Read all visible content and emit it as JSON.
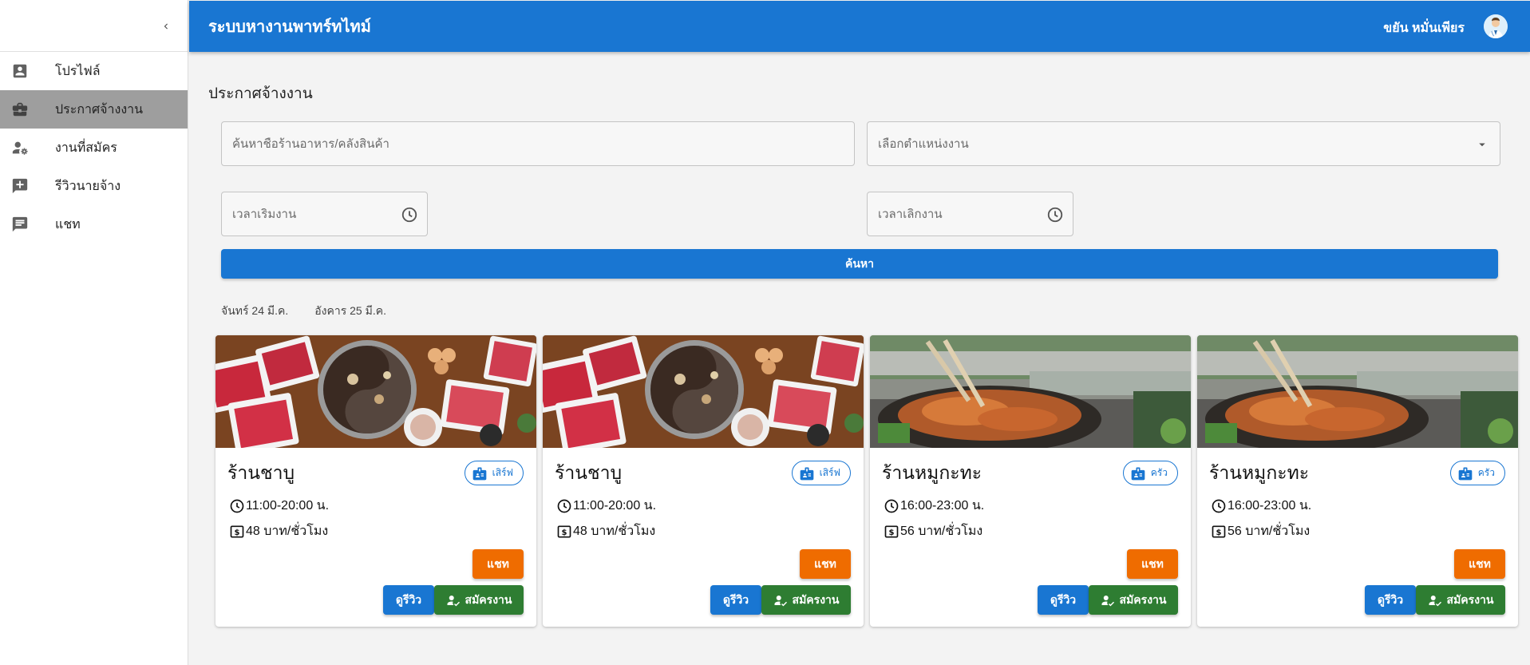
{
  "app": {
    "title": "ระบบหางานพาทร์ทไทม์",
    "user_name": "ขยัน หมั่นเพียร"
  },
  "sidebar": {
    "items": [
      {
        "label": "โปรไฟล์",
        "icon": "account-box-icon"
      },
      {
        "label": "ประกาศจ้างงาน",
        "icon": "briefcase-icon",
        "active": true
      },
      {
        "label": "งานที่สมัคร",
        "icon": "person-gear-icon"
      },
      {
        "label": "รีวิวนายจ้าง",
        "icon": "add-comment-icon"
      },
      {
        "label": "แชท",
        "icon": "chat-icon"
      }
    ]
  },
  "main": {
    "title": "ประกาศจ้างงาน",
    "search_placeholder": "ค้นหาชื่อร้านอาหาร/คลังสินค้า",
    "position_select_label": "เลือกตำแหน่งงาน",
    "start_time_placeholder": "เวลาเริ่มงาน",
    "end_time_placeholder": "เวลาเลิกงาน",
    "search_button": "ค้นหา",
    "date_tabs": [
      "จันทร์ 24 มี.ค.",
      "อังคาร 25 มี.ค."
    ]
  },
  "buttons": {
    "chat": "แชท",
    "review": "ดูรีวิว",
    "apply": "สมัครงาน"
  },
  "jobs": [
    {
      "name": "ร้านชาบู",
      "position": "เสิร์ฟ",
      "time": "11:00-20:00 น.",
      "wage": "48 บาท/ชั่วโมง",
      "image": "shabu"
    },
    {
      "name": "ร้านชาบู",
      "position": "เสิร์ฟ",
      "time": "11:00-20:00 น.",
      "wage": "48 บาท/ชั่วโมง",
      "image": "shabu"
    },
    {
      "name": "ร้านหมูกะทะ",
      "position": "ครัว",
      "time": "16:00-23:00 น.",
      "wage": "56 บาท/ชั่วโมง",
      "image": "bbq"
    },
    {
      "name": "ร้านหมูกะทะ",
      "position": "ครัว",
      "time": "16:00-23:00 น.",
      "wage": "56 บาท/ชั่วโมง",
      "image": "bbq"
    }
  ],
  "colors": {
    "primary": "#1976d2",
    "orange": "#ef6c00",
    "green": "#2e7d32",
    "active_nav": "#9e9e9e"
  }
}
